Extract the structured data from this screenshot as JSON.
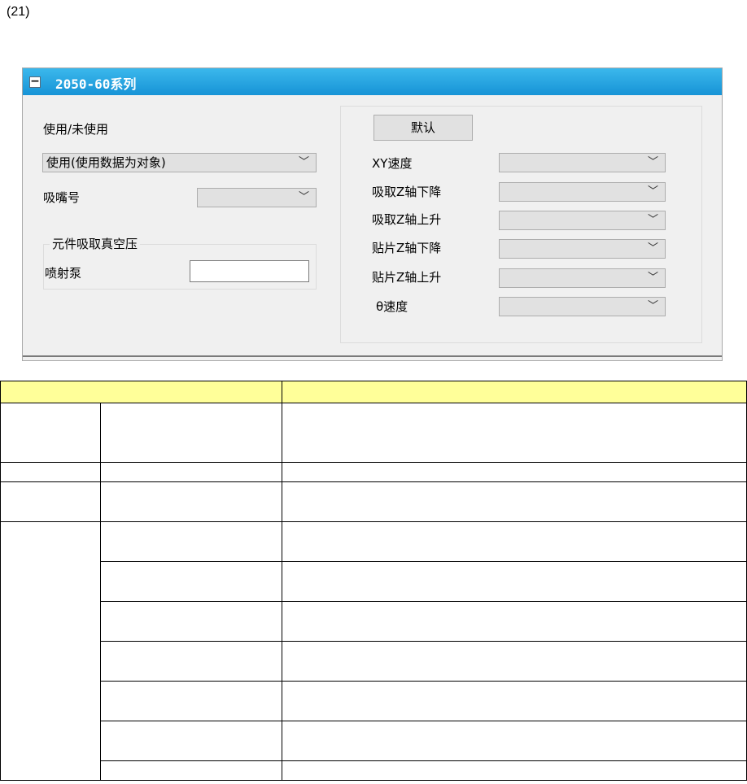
{
  "page": {
    "section_number": "(21)"
  },
  "panel": {
    "title": "2050-60系列",
    "collapse_glyph": "−",
    "use_label": "使用/未使用",
    "use_select_value": "使用(使用数据为对象)",
    "nozzle_label": "吸嘴号",
    "nozzle_select_value": "",
    "vacuum_group_legend": "元件吸取真空压",
    "ejector_label": "喷射泵",
    "ejector_value": "",
    "default_button": "默认",
    "speed_rows": [
      {
        "label": "XY速度",
        "value": ""
      },
      {
        "label": "吸取Z轴下降",
        "value": ""
      },
      {
        "label": "吸取Z轴上升",
        "value": ""
      },
      {
        "label": "贴片Z轴下降",
        "value": ""
      },
      {
        "label": "贴片Z轴上升",
        "value": ""
      },
      {
        "label": "θ速度",
        "value": ""
      }
    ],
    "dropdown_arrow": "﹀"
  },
  "table": {
    "header_color": "#ffff99",
    "rows": [
      {
        "a": "",
        "b": "",
        "c": ""
      },
      {
        "a": "",
        "b": "",
        "c": ""
      },
      {
        "a": "",
        "b": "",
        "c": ""
      },
      {
        "a": "",
        "b": "",
        "c": ""
      },
      {
        "a": "",
        "b": "",
        "c": ""
      },
      {
        "a": "",
        "b": "",
        "c": ""
      },
      {
        "a": "",
        "b": "",
        "c": ""
      },
      {
        "a": "",
        "b": "",
        "c": ""
      },
      {
        "a": "",
        "b": "",
        "c": ""
      },
      {
        "a": "",
        "b": "",
        "c": ""
      }
    ]
  }
}
